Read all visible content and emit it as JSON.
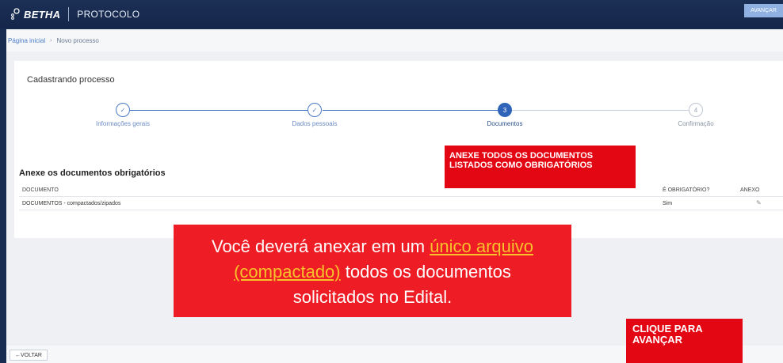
{
  "header": {
    "brand": "BETHA",
    "module": "PROTOCOLO",
    "logo_icon": "betha-logo-icon"
  },
  "breadcrumb": {
    "home": "Página inicial",
    "current": "Novo processo"
  },
  "card": {
    "title": "Cadastrando processo"
  },
  "stepper": {
    "steps": [
      {
        "label": "Informações gerais",
        "marker": "✓",
        "state": "done"
      },
      {
        "label": "Dados pessoais",
        "marker": "✓",
        "state": "done"
      },
      {
        "label": "Documentos",
        "marker": "3",
        "state": "active"
      },
      {
        "label": "Confirmação",
        "marker": "4",
        "state": "pending"
      }
    ]
  },
  "documents": {
    "section_title": "Anexe os documentos obrigatórios",
    "columns": [
      "DOCUMENTO",
      "É OBRIGATÓRIO?",
      "ANEXO"
    ],
    "rows": [
      {
        "documento": "DOCUMENTOS - compactados/zipados",
        "obrigatorio": "Sim",
        "anexo_icon": "paperclip-icon"
      }
    ]
  },
  "callouts": {
    "anexe_line1": "ANEXE  TODOS OS DOCUMENTOS",
    "anexe_line2": "LISTADOS COMO OBRIGATÓRIOS",
    "main_part1": "Você deverá anexar em um ",
    "main_highlight1": "único arquivo",
    "main_highlight2": "(compactado)",
    "main_part2": " todos os documentos",
    "main_part3": "solicitados no Edital.",
    "clique_line1": "CLIQUE PARA",
    "clique_line2": "AVANÇAR"
  },
  "footer": {
    "back_label": "VOLTAR",
    "next_label": "AVANÇAR"
  },
  "colors": {
    "accent": "#2f64b8",
    "callout_red": "#e30613",
    "highlight_yellow": "#f7c22b"
  }
}
